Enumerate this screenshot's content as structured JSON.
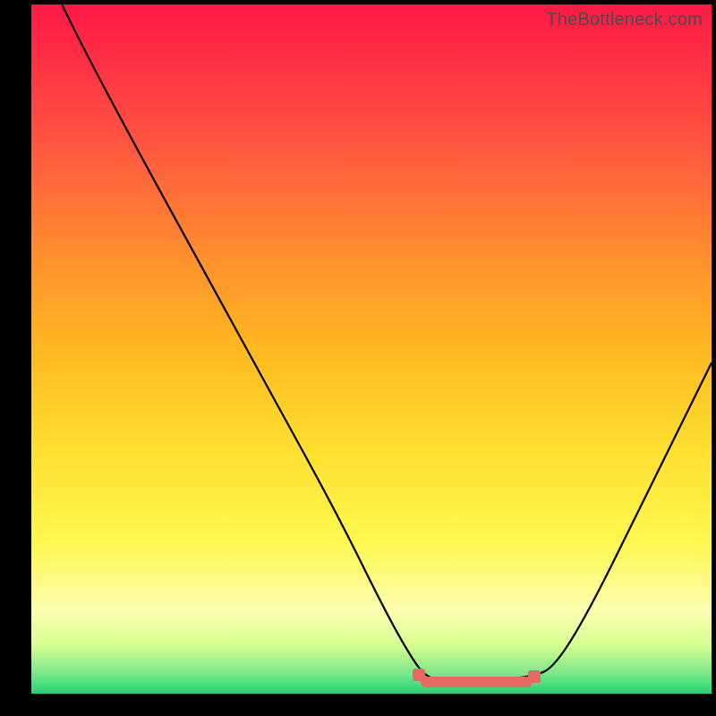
{
  "watermark": "TheBottleneck.com",
  "colors": {
    "marker": "#e66a62",
    "curve": "#000000"
  },
  "chart_data": {
    "type": "line",
    "title": "",
    "xlabel": "",
    "ylabel": "",
    "x_range_pct": [
      0,
      100
    ],
    "y_range_pct": [
      0,
      100
    ],
    "series": [
      {
        "name": "bottleneck-curve",
        "points_pct": [
          [
            4.5,
            100
          ],
          [
            8,
            93
          ],
          [
            15,
            80
          ],
          [
            25,
            62
          ],
          [
            35,
            44
          ],
          [
            45,
            26
          ],
          [
            52,
            12
          ],
          [
            56,
            5
          ],
          [
            58,
            2.5
          ],
          [
            60,
            2
          ],
          [
            68,
            2
          ],
          [
            74,
            2.5
          ],
          [
            77,
            4
          ],
          [
            82,
            12
          ],
          [
            90,
            28
          ],
          [
            100,
            48
          ]
        ]
      }
    ],
    "optimal_band_pct": {
      "start": 57,
      "end": 74,
      "y": 2
    }
  }
}
